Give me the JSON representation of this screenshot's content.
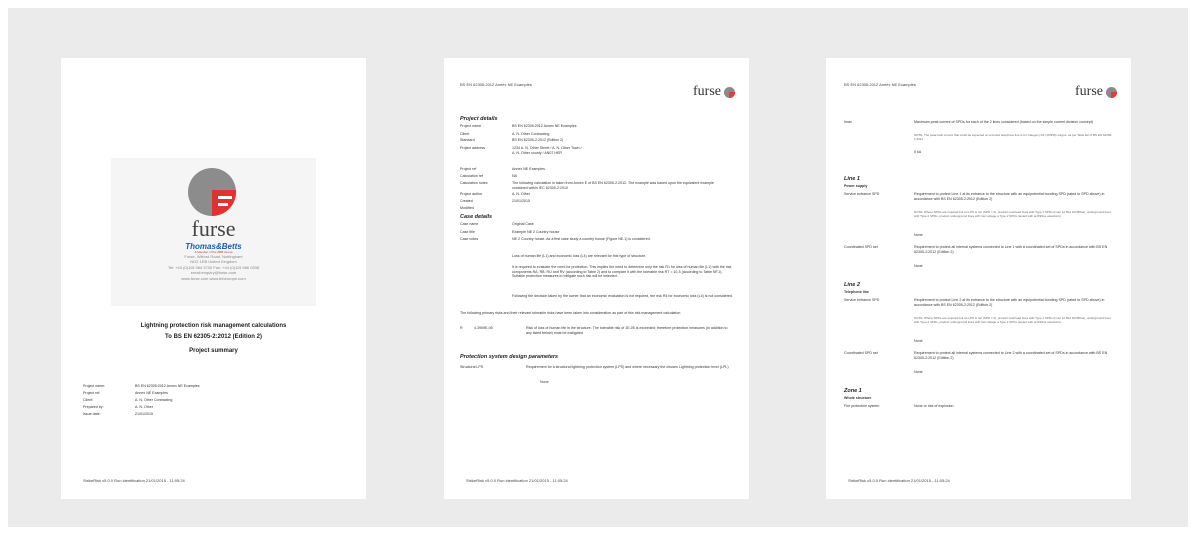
{
  "page1": {
    "logo_text": "furse",
    "brand": "Thomas&Betts",
    "brand_sub": "A Member of the ABB Group",
    "address": [
      "Furse, Wilford Road, Nottingham",
      "NG2 1EB United Kingdom",
      "Tel: +44 (0)115 964 3700  Fax: +44 (0)115 986 0538",
      "email:enquiry@furse.com",
      "www.furse.com  www.tnbeurope.com"
    ],
    "title_line1": "Lightning protection risk management calculations",
    "title_line2": "To BS EN 62305-2:2012 (Edition 2)",
    "subtitle": "Project summary",
    "details": [
      {
        "k": "Project name:",
        "v": "BS EN 62305:2012 Annex NE Examples"
      },
      {
        "k": "Project ref:",
        "v": "Annex NE Examples"
      },
      {
        "k": "Client:",
        "v": "A. N. Other Contracting"
      },
      {
        "k": "Prepared by:",
        "v": "A. N. Other"
      },
      {
        "k": "Issue date:",
        "v": "21/01/2015"
      }
    ],
    "footer": "StrikeRisk v5.0.0 Run identification 21/01/2015 - 11:05:24"
  },
  "page2": {
    "header": "BS EN 62305:2012 Annex NE Examples",
    "logo_text": "furse",
    "section1": "Project details",
    "project_rows": [
      {
        "k": "Project name",
        "v": "BS EN 62305:2012 Annex NE Examples"
      },
      {
        "k": "Client",
        "v": "A. N. Other Contracting"
      },
      {
        "k": "Standard",
        "v": "BS EN 62305-2:2012 (Edition 2)"
      },
      {
        "k": "Project address",
        "v": "1234 A. N. Other Street / A. N. Other Town / A. N. Other county / AN07 HER"
      },
      {
        "k": "Project ref",
        "v": "Annex NE Examples"
      },
      {
        "k": "Calculation ref",
        "v": "NA"
      },
      {
        "k": "Calculation notes",
        "v": "The following calculation is taken from Annex E of BS EN 62305-2:2012. The example was based upon the equivalent example contained within IEC 62305-2:2010"
      },
      {
        "k": "Project author",
        "v": "A. N. Other"
      },
      {
        "k": "Created",
        "v": "21/01/2015"
      },
      {
        "k": "Modified",
        "v": ""
      }
    ],
    "section2": "Case details",
    "case_rows": [
      {
        "k": "Case name",
        "v": "Original Case"
      },
      {
        "k": "Case title",
        "v": "Example NE 2 Country house"
      },
      {
        "k": "Case notes",
        "v": "NE 2 Country house. As a first case study a country house (Figure NE.1) is considered."
      }
    ],
    "case_para1": "Loss of human life (L1) and economic loss (L4) are relevant for this type of structure.",
    "case_para2": "It is required to evaluate the need for protection. This implies the need to determine only the risk R1 for loss of human life (L1) with the risk components RA, RB, RU and RV (according to Table 2) and to compare it with the tolerable risk RT = 10-5 (according to Table NF.1). Suitable protection measures to mitigate such risk will be selected.",
    "case_para3": "Following the decision taken by the owner that an economic evaluation is not required, the risk R4 for economic loss (L4) is not considered.",
    "primary_note": "The following primary risks and their relevant tolerable risks have been taken into consideration as part of this risk management calculation",
    "risk_label": "R",
    "risk_value": "4.3909E-05",
    "risk_text": "Risk of loss of human life in the structure. The tolerable risk of 1E-05 is exceeded; therefore protection measures (in addition to any listed below) must be instigated",
    "section3": "Protection system design parameters",
    "lps_k": "Structural LPS",
    "lps_v": "Requirement for a structural lightning protection system (LPS) and where necessary the chosen Lightning protection level (LPL)",
    "lps_none": "None",
    "footer": "StrikeRisk v5.0.0 Run identification 21/01/2015 - 11:05:24"
  },
  "page3": {
    "header": "BS EN 62305:2012 Annex NE Examples",
    "logo_text": "furse",
    "imax_k": "Imax",
    "imax_v": "Maximum peak current of SPDs for each of the 2 lines considered (based on the simple current division concept)",
    "imax_note": "NOTE: The peak fault current that could be expected on a buried telephone line is for Category D1 (10/350) surges, as per Table E2 of BS EN 62305-1:2011",
    "imax_val": "0 kA",
    "line1": "Line 1",
    "line1_sub": "Power supply",
    "l1_sev_k": "Service entrance SPD",
    "l1_sev_v": "Requirement to protect Line 1 at its entrance to the structure with an equipotential bonding SPD (rated to SPD above) in accordance with BS EN 62305-2:2012 (Edition 2)",
    "l1_note": "NOTE: Where SPDs are required but an LPS is not (SPD = 0), product overhead lines with Type 1 SPDs (Imax 12.5kA 10/350us), underground lines with Type 2 SPDs, product underground lines with low voltage a Type 2 SPDs (tested with at 8/20us waveform).",
    "l1_none": "None",
    "l1_coord_k": "Coordinated SPD set",
    "l1_coord_v": "Requirement to protect all internal systems connected to Line 1 with a coordinated set of SPDs in accordance with BS EN 62305-2:2012 (Edition 2)",
    "l1_coord_none": "None",
    "line2": "Line 2",
    "line2_sub": "Telephone line",
    "l2_sev_k": "Service entrance SPD",
    "l2_sev_v": "Requirement to protect Line 2 at its entrance to the structure with an equipotential bonding SPD (rated to SPD above) in accordance with BS EN 62305-2:2012 (Edition 2)",
    "l2_note": "NOTE: Where SPDs are required but an LPS is not (SPD = 0), product overhead lines with Type 1 SPDs (Imax 12.5kA 10/350us), underground lines with Type 2 SPDs, product underground lines with low voltage a Type 2 SPDs (tested with at 8/20us waveform).",
    "l2_none": "None",
    "l2_coord_k": "Coordinated SPD set",
    "l2_coord_v": "Requirement to protect all internal systems connected to Line 2 with a coordinated set of SPDs in accordance with BS EN 62305-2:2012 (Edition 2)",
    "l2_coord_none": "None",
    "zone": "Zone 1",
    "zone_sub": "Whole structure",
    "fire_k": "Fire protection system",
    "fire_v": "None or risk of explosion",
    "footer": "StrikeRisk v5.0.0 Run identification 21/01/2015 - 11:05:24"
  }
}
